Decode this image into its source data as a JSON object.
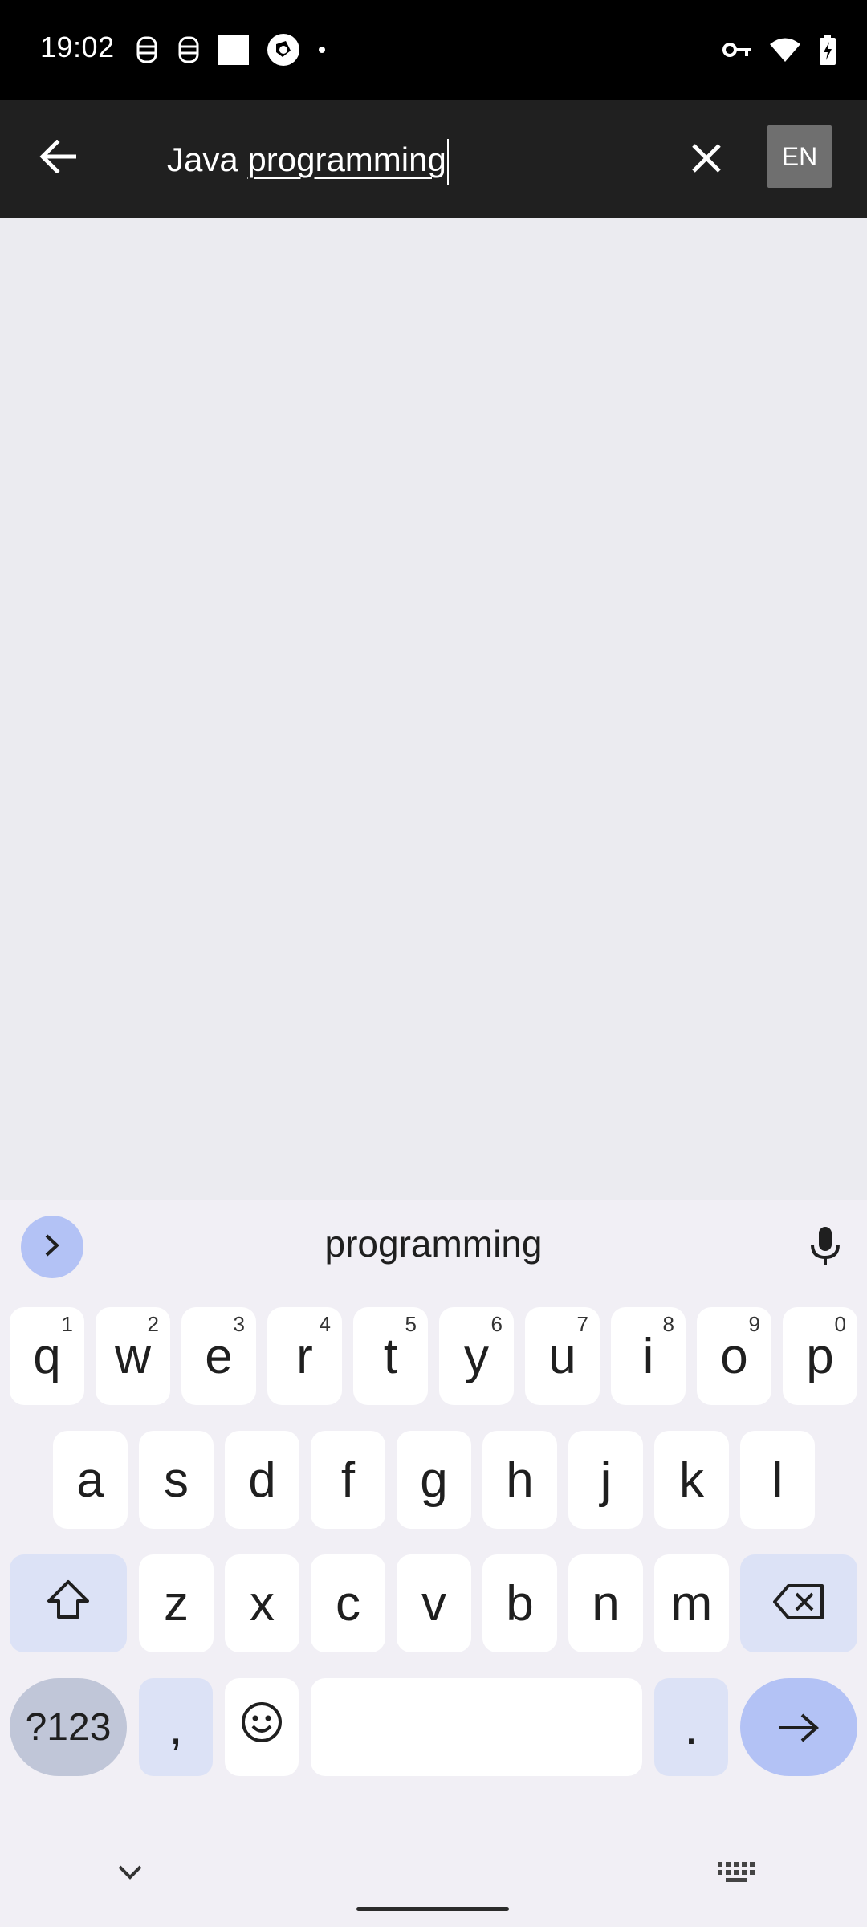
{
  "status_bar": {
    "time": "19:02",
    "left_icons": [
      "notification-icon-1",
      "notification-icon-2",
      "square-notification-icon",
      "camera-aperture-icon",
      "dot-more-icon"
    ],
    "right_icons": [
      "vpn-key-icon",
      "wifi-icon",
      "battery-charging-icon"
    ]
  },
  "app_bar": {
    "back_icon": "arrow-left-icon",
    "search_prefix": "Java ",
    "search_composing": "programming",
    "clear_icon": "close-icon",
    "language_button": "EN"
  },
  "keyboard": {
    "suggestion": "programming",
    "row1": [
      {
        "label": "q",
        "hint": "1"
      },
      {
        "label": "w",
        "hint": "2"
      },
      {
        "label": "e",
        "hint": "3"
      },
      {
        "label": "r",
        "hint": "4"
      },
      {
        "label": "t",
        "hint": "5"
      },
      {
        "label": "y",
        "hint": "6"
      },
      {
        "label": "u",
        "hint": "7"
      },
      {
        "label": "i",
        "hint": "8"
      },
      {
        "label": "o",
        "hint": "9"
      },
      {
        "label": "p",
        "hint": "0"
      }
    ],
    "row2": [
      "a",
      "s",
      "d",
      "f",
      "g",
      "h",
      "j",
      "k",
      "l"
    ],
    "row3": [
      "z",
      "x",
      "c",
      "v",
      "b",
      "n",
      "m"
    ],
    "symbols_key": "?123",
    "comma_key": ",",
    "period_key": ".",
    "icons": {
      "expand": "chevron-right-icon",
      "mic": "microphone-icon",
      "shift": "shift-icon",
      "backspace": "backspace-icon",
      "emoji": "emoji-icon",
      "enter": "arrow-right-icon",
      "hide": "chevron-down-icon",
      "switch": "keyboard-icon"
    }
  },
  "colors": {
    "app_bar": "#202020",
    "content_bg": "#ebebf0",
    "keyboard_bg": "#f1eff5",
    "accent": "#b3c2f5"
  }
}
